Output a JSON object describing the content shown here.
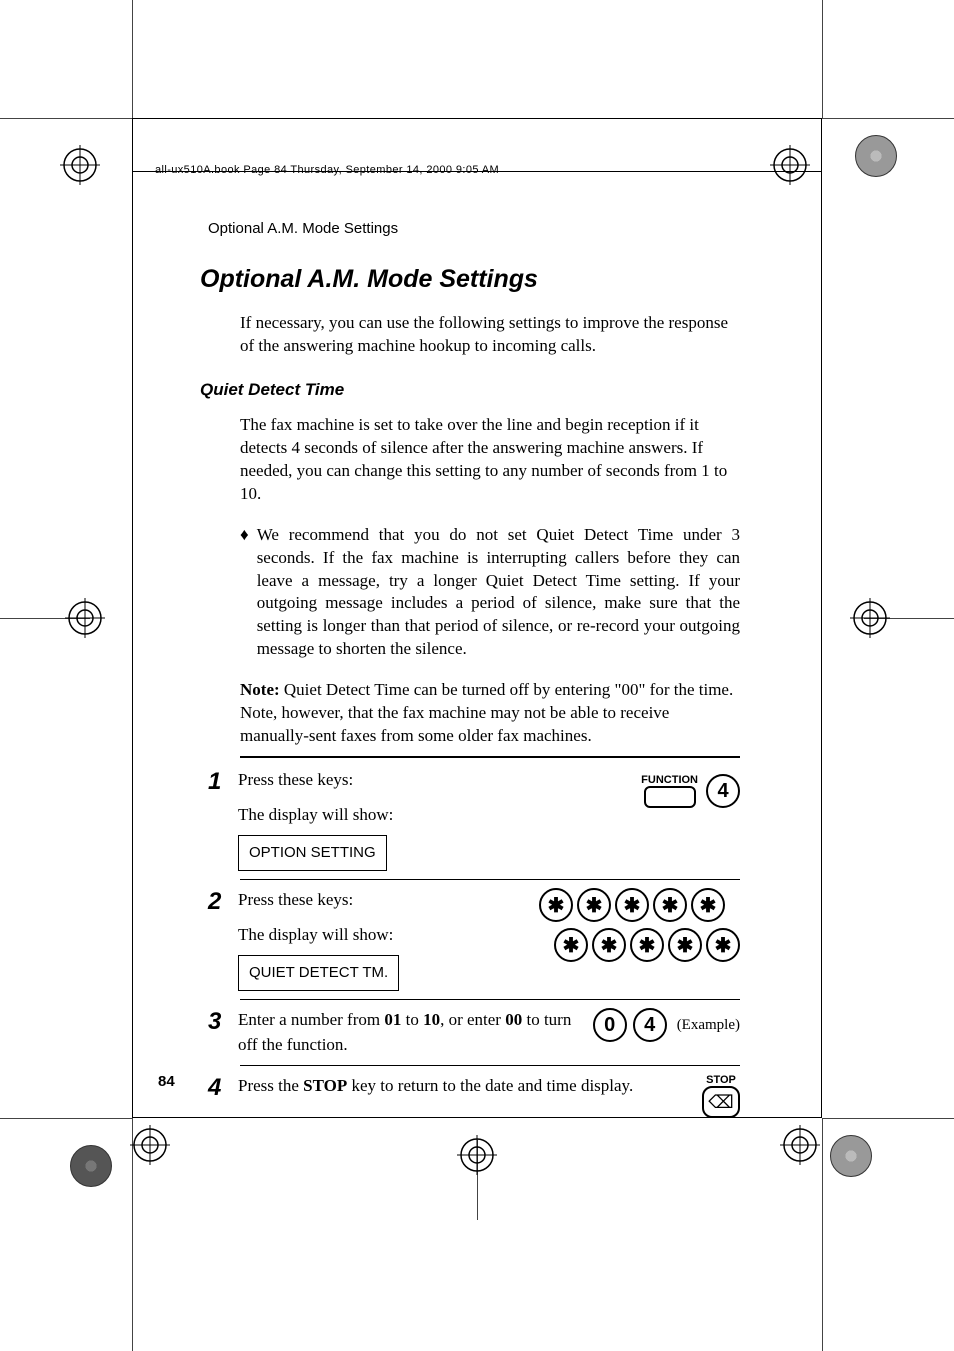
{
  "print_meta": "all-ux510A.book  Page 84  Thursday, September 14, 2000  9:05 AM",
  "running_header": "Optional A.M. Mode Settings",
  "title": "Optional A.M. Mode Settings",
  "intro": "If necessary, you can use the following settings to improve the response of the answering machine hookup to incoming calls.",
  "subhead": "Quiet Detect Time",
  "para1": "The fax machine is set to take over the line and begin reception if it detects 4 seconds of silence after the answering machine answers. If needed, you can change this setting to any number of seconds from 1 to 10.",
  "bullet1": "We recommend that you do not set Quiet Detect Time under 3 seconds. If the fax machine is interrupting callers before they can leave a message, try a longer Quiet Detect Time setting. If your outgoing message includes a period of silence, make sure that the setting is longer than that period of silence, or re-record your outgoing message to shorten the silence.",
  "note_bold": "Note:",
  "note_text": " Quiet Detect Time can be turned off by entering \"00\" for the time. Note, however, that the fax machine may not be able to receive manually-sent faxes from some older fax machines.",
  "steps": {
    "s1": {
      "num": "1",
      "line1": "Press these keys:",
      "line2": "The display will show:",
      "display": "OPTION SETTING",
      "func_label": "FUNCTION",
      "key": "4"
    },
    "s2": {
      "num": "2",
      "line1": "Press these keys:",
      "line2": "The display will show:",
      "display": "QUIET DETECT TM."
    },
    "s3": {
      "num": "3",
      "text_a": "Enter a number from ",
      "text_b": "01",
      "text_c": " to ",
      "text_d": "10",
      "text_e": ", or enter ",
      "text_f": "00",
      "text_g": " to turn off the function.",
      "k1": "0",
      "k2": "4",
      "example": "(Example)"
    },
    "s4": {
      "num": "4",
      "text_a": "Press the ",
      "text_b": "STOP",
      "text_c": " key to return to the date and time display.",
      "stop_label": "STOP"
    }
  },
  "page_number": "84"
}
